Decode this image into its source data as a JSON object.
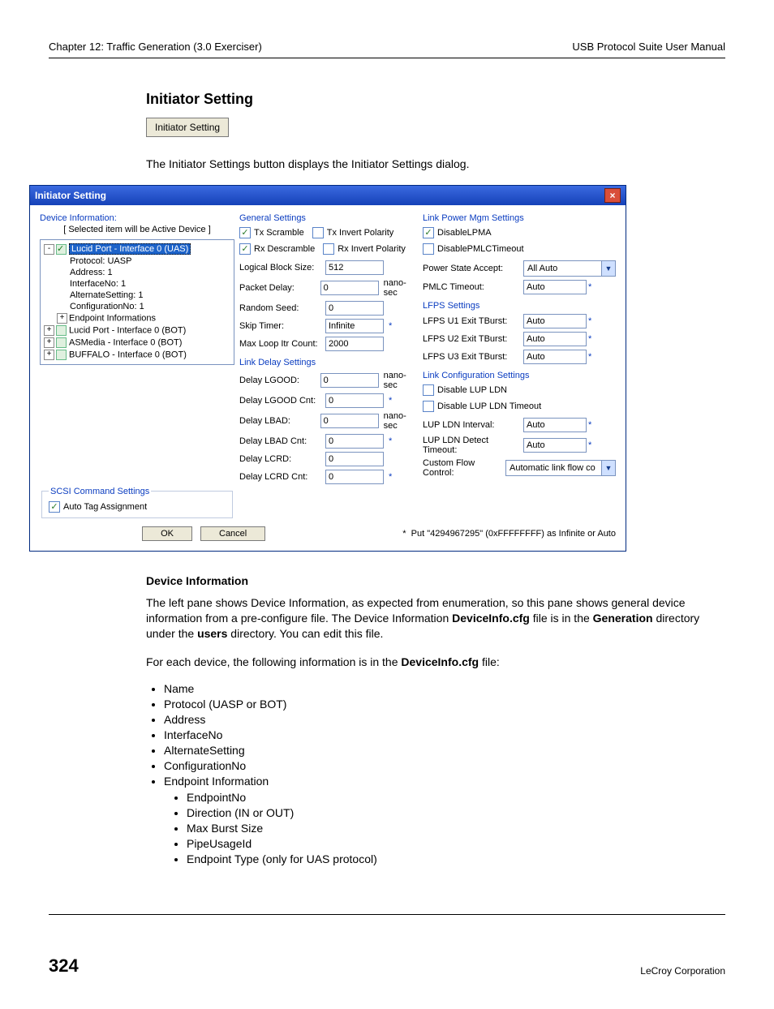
{
  "header": {
    "left": "Chapter 12: Traffic Generation (3.0 Exerciser)",
    "right": "USB Protocol Suite User Manual"
  },
  "section": {
    "title": "Initiator Setting",
    "button_label": "Initiator Setting",
    "intro": "The Initiator Settings button displays the Initiator Settings dialog."
  },
  "dialog": {
    "title": "Initiator Setting",
    "left": {
      "device_info_title": "Device Information:",
      "device_info_note": "[ Selected item will be Active Device  ]",
      "tree": {
        "n0": "Lucid Port - Interface 0 (UAS)",
        "n0_children": {
          "c0": "Protocol: UASP",
          "c1": "Address: 1",
          "c2": "InterfaceNo: 1",
          "c3": "AlternateSetting: 1",
          "c4": "ConfigurationNo: 1",
          "c5": "Endpoint Informations"
        },
        "n1": "Lucid Port - Interface 0 (BOT)",
        "n2": "ASMedia - Interface 0 (BOT)",
        "n3": "BUFFALO - Interface 0 (BOT)"
      },
      "scsi_group_title": "SCSI Command Settings",
      "auto_tag": "Auto Tag Assignment"
    },
    "mid": {
      "general_title": "General Settings",
      "tx_scramble": "Tx Scramble",
      "tx_invert": "Tx Invert Polarity",
      "rx_descramble": "Rx Descramble",
      "rx_invert": "Rx Invert Polarity",
      "lbl_lbs": "Logical Block Size:",
      "val_lbs": "512",
      "lbl_pd": "Packet Delay:",
      "val_pd": "0",
      "unit_ns": "nano-sec",
      "lbl_rs": "Random Seed:",
      "val_rs": "0",
      "lbl_st": "Skip Timer:",
      "val_st": "Infinite",
      "lbl_mlic": "Max Loop Itr Count:",
      "val_mlic": "2000",
      "link_delay_title": "Link Delay Settings",
      "lbl_dlg": "Delay LGOOD:",
      "val_dlg": "0",
      "lbl_dlgc": "Delay LGOOD Cnt:",
      "val_dlgc": "0",
      "lbl_dlb": "Delay LBAD:",
      "val_dlb": "0",
      "lbl_dlbc": "Delay LBAD Cnt:",
      "val_dlbc": "0",
      "lbl_dlc": "Delay LCRD:",
      "val_dlc": "0",
      "lbl_dlcc": "Delay LCRD Cnt:",
      "val_dlcc": "0"
    },
    "right": {
      "lpm_title": "Link Power Mgm Settings",
      "dis_lpma": "DisableLPMA",
      "dis_pmlc": "DisablePMLCTimeout",
      "lbl_psa": "Power State Accept:",
      "val_psa": "All Auto",
      "lbl_pmlc": "PMLC Timeout:",
      "val_pmlc": "Auto",
      "lfps_title": "LFPS Settings",
      "lbl_lfps1": "LFPS U1 Exit TBurst:",
      "val_lfps1": "Auto",
      "lbl_lfps2": "LFPS U2 Exit TBurst:",
      "val_lfps2": "Auto",
      "lbl_lfps3": "LFPS U3 Exit TBurst:",
      "val_lfps3": "Auto",
      "lc_title": "Link Configuration Settings",
      "dis_lupldn": "Disable LUP LDN",
      "dis_lupldn_to": "Disable LUP LDN Timeout",
      "lbl_lli": "LUP LDN Interval:",
      "val_lli": "Auto",
      "lbl_lldt": "LUP LDN Detect Timeout:",
      "val_lldt": "Auto",
      "lbl_cfc": "Custom Flow Control:",
      "val_cfc": "Automatic link flow co"
    },
    "ok": "OK",
    "cancel": "Cancel",
    "footnote_star": "*",
    "footnote": "Put \"4294967295\" (0xFFFFFFFF) as Infinite or Auto"
  },
  "doc": {
    "devinfo_title": "Device Information",
    "p1a": "The left pane shows Device Information, as expected from enumeration, so this pane shows general device information from a pre-configure file. The Device Information ",
    "b1": "DeviceInfo.cfg",
    "p1b": " file is in the ",
    "b2": "Generation",
    "p1c": " directory under the ",
    "b3": "users",
    "p1d": " directory. You can edit this file.",
    "p2a": "For each device, the following information is in the ",
    "b4": "DeviceInfo.cfg",
    "p2b": " file:",
    "bullets": {
      "i0": "Name",
      "i1": "Protocol (UASP or BOT)",
      "i2": "Address",
      "i3": "InterfaceNo",
      "i4": "AlternateSetting",
      "i5": "ConfigurationNo",
      "i6": "Endpoint Information",
      "sub": {
        "s0": "EndpointNo",
        "s1": "Direction (IN or OUT)",
        "s2": "Max Burst Size",
        "s3": "PipeUsageId",
        "s4": "Endpoint Type (only for UAS protocol)"
      }
    }
  },
  "footer": {
    "page": "324",
    "company": "LeCroy Corporation"
  }
}
